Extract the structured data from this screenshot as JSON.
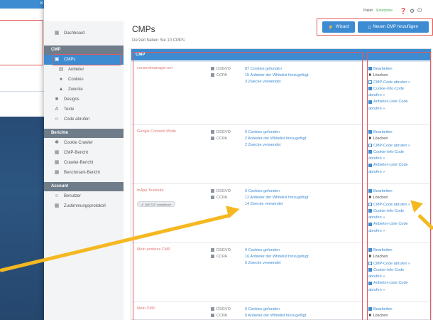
{
  "topbar": {
    "plan_label": "Paket:",
    "plan_value": "Enterprise"
  },
  "sidebar": {
    "items_top": [
      {
        "label": "Dashboard",
        "icon": "grid-icon",
        "glyph": "▦"
      }
    ],
    "section_cmp": "CMP",
    "cmp_items": [
      {
        "label": "CMPs",
        "icon": "file-icon",
        "glyph": "▣",
        "active": true
      },
      {
        "label": "Anbieter",
        "icon": "list-icon",
        "glyph": "▤"
      },
      {
        "label": "Cookies",
        "icon": "cookie-icon",
        "glyph": "●"
      },
      {
        "label": "Zwecke",
        "icon": "tag-icon",
        "glyph": "▲"
      }
    ],
    "cmp_items_2": [
      {
        "label": "Designs",
        "icon": "brush-icon",
        "glyph": "■"
      },
      {
        "label": "Texte",
        "icon": "text-icon",
        "glyph": "A"
      },
      {
        "label": "Code abrufen",
        "icon": "code-icon",
        "glyph": "‹›"
      }
    ],
    "section_reports": "Berichte",
    "report_items": [
      {
        "label": "Cookie Crawler",
        "icon": "bug-icon",
        "glyph": "✱"
      },
      {
        "label": "CMP-Bericht",
        "icon": "report-icon",
        "glyph": "▦"
      },
      {
        "label": "Crawler-Bericht",
        "icon": "report-icon",
        "glyph": "▦"
      },
      {
        "label": "Benchmark-Bericht",
        "icon": "report-icon",
        "glyph": "▦"
      }
    ],
    "section_account": "Account",
    "account_items": [
      {
        "label": "Benutzer",
        "icon": "users-icon",
        "glyph": "☺"
      },
      {
        "label": "Zustimmungsprotokoll",
        "icon": "log-icon",
        "glyph": "▦"
      }
    ]
  },
  "main": {
    "title": "CMPs",
    "subtitle": "Derzeit haben Sie 10 CMPs:",
    "wizard_label": "Wizard",
    "new_label": "Neuen CMP hinzufügen",
    "table_header": "CMP",
    "rows": [
      {
        "name": "consentmanager.net",
        "checks": [
          "DSGVO",
          "CCPA"
        ],
        "stats": [
          "87 Cookies gefunden",
          "15 Anbieter der Whitelist hinzugefügt",
          "3 Zwecke verwendet"
        ],
        "badge": null
      },
      {
        "name": "Google Consent Mode",
        "checks": [
          "DSGVO",
          "CCPA"
        ],
        "stats": [
          "0 Cookies gefunden",
          "2 Anbieter der Whitelist hinzugefügt",
          "2 Zwecke verwendet"
        ],
        "badge": null
      },
      {
        "name": "mApp Testseite",
        "checks": [
          "DSGVO",
          "CCPA"
        ],
        "stats": [
          "0 Cookies gefunden",
          "12 Anbieter der Whitelist hinzugefügt",
          "14 Zwecke verwendet"
        ],
        "badge": "IAB TCF compliance"
      },
      {
        "name": "Mein anderes CMP",
        "checks": [
          "DSGVO",
          "CCPA"
        ],
        "stats": [
          "0 Cookies gefunden",
          "16 Anbieter der Whitelist hinzugefügt",
          "5 Zwecke verwendet"
        ],
        "badge": null
      },
      {
        "name": "Mein CMP",
        "checks": [
          "DSGVO",
          "CCPA"
        ],
        "stats": [
          "0 Cookies gefunden",
          "0 Anbieter der Whitelist hinzugefügt"
        ],
        "badge": null
      }
    ],
    "actions": {
      "edit": "Bearbeiten",
      "delete": "Löschen",
      "cmp_code": "CMP-Code abrufen »",
      "cookie_code": "Cookie-Info-Code",
      "cookie_code_2": "abrufen »",
      "vendor_code": "Anbieter-Liste Code",
      "vendor_code_2": "abrufen »"
    }
  },
  "colors": {
    "accent": "#3d8bd1",
    "highlight": "#e35b5b",
    "arrow": "#f5b820"
  }
}
